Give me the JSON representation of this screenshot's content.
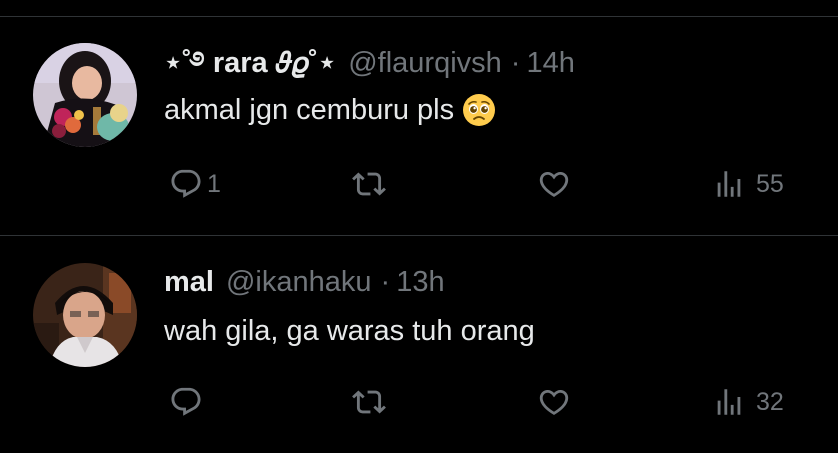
{
  "colors": {
    "background": "#000000",
    "primary_text": "#e7e9ea",
    "secondary_text": "#71767b",
    "divider": "#2f3336"
  },
  "tweets": [
    {
      "display_name": "⋆˚࿔ rara 𝜗𝜚˚⋆",
      "handle": "@flaurqivsh",
      "separator": "·",
      "time": "14h",
      "text": "akmal jgn cemburu pls",
      "emoji": "pleading-face",
      "reply_count": "1",
      "retweet_count": "",
      "like_count": "",
      "views_count": "55",
      "avatar": "user-avatar-rara"
    },
    {
      "display_name": "mal",
      "handle": "@ikanhaku",
      "separator": "·",
      "time": "13h",
      "text": "wah gila, ga waras tuh orang",
      "reply_count": "",
      "retweet_count": "",
      "like_count": "",
      "views_count": "32",
      "avatar": "user-avatar-mal"
    }
  ],
  "icons": {
    "reply": "reply-icon",
    "retweet": "retweet-icon",
    "like": "like-icon",
    "views": "views-icon"
  }
}
